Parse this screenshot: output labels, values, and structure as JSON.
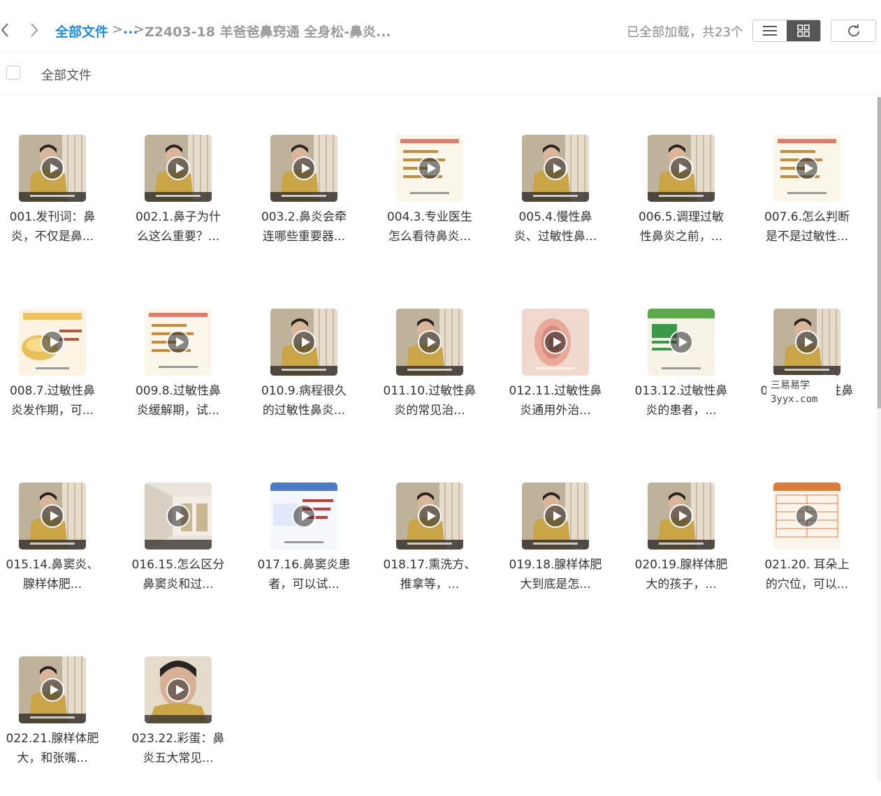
{
  "header": {
    "breadcrumb_root": "全部文件",
    "breadcrumb_sep1": ">",
    "breadcrumb_ellipsis": "...",
    "breadcrumb_sep2": ">",
    "breadcrumb_current": "Z2403-18 羊爸爸鼻窍通 全身松-鼻炎...",
    "status": "已全部加载，共23个"
  },
  "selectbar": {
    "label": "全部文件"
  },
  "watermark": {
    "line1": "三易易学",
    "line2": "3yyx.com"
  },
  "colors": {
    "accent": "#1e8be6",
    "muted": "#9a9a9a"
  },
  "files": [
    {
      "name": "001.发刊词：鼻炎，不仅是鼻...",
      "thumb": "person"
    },
    {
      "name": "002.1.鼻子为什么这么重要？...",
      "thumb": "person"
    },
    {
      "name": "003.2.鼻炎会牵连哪些重要器...",
      "thumb": "person"
    },
    {
      "name": "004.3.专业医生怎么看待鼻炎...",
      "thumb": "slide"
    },
    {
      "name": "005.4.慢性鼻炎、过敏性鼻...",
      "thumb": "person"
    },
    {
      "name": "006.5.调理过敏性鼻炎之前，...",
      "thumb": "person"
    },
    {
      "name": "007.6.怎么判断是不是过敏性...",
      "thumb": "slide"
    },
    {
      "name": "008.7.过敏性鼻炎发作期，可...",
      "thumb": "food"
    },
    {
      "name": "009.8.过敏性鼻炎缓解期，试...",
      "thumb": "slide"
    },
    {
      "name": "010.9.病程很久的过敏性鼻炎...",
      "thumb": "person"
    },
    {
      "name": "011.10.过敏性鼻炎的常见治...",
      "thumb": "person"
    },
    {
      "name": "012.11.过敏性鼻炎通用外治...",
      "thumb": "ear"
    },
    {
      "name": "013.12.过敏性鼻炎的患者，...",
      "thumb": "green"
    },
    {
      "name": "014.13.过敏性鼻炎，一起...",
      "thumb": "person"
    },
    {
      "name": "015.14.鼻窦炎、腺样体肥...",
      "thumb": "person"
    },
    {
      "name": "016.15.怎么区分鼻窦炎和过...",
      "thumb": "room"
    },
    {
      "name": "017.16.鼻窦炎患者，可以试...",
      "thumb": "slideblue"
    },
    {
      "name": "018.17.熏洗方、推拿等，...",
      "thumb": "person"
    },
    {
      "name": "019.18.腺样体肥大到底是怎...",
      "thumb": "person"
    },
    {
      "name": "020.19.腺样体肥大的孩子，...",
      "thumb": "person"
    },
    {
      "name": "021.20. 耳朵上的穴位，可以...",
      "thumb": "table"
    },
    {
      "name": "022.21.腺样体肥大，和张嘴...",
      "thumb": "person"
    },
    {
      "name": "023.22.彩蛋：鼻炎五大常见...",
      "thumb": "closeup"
    }
  ]
}
